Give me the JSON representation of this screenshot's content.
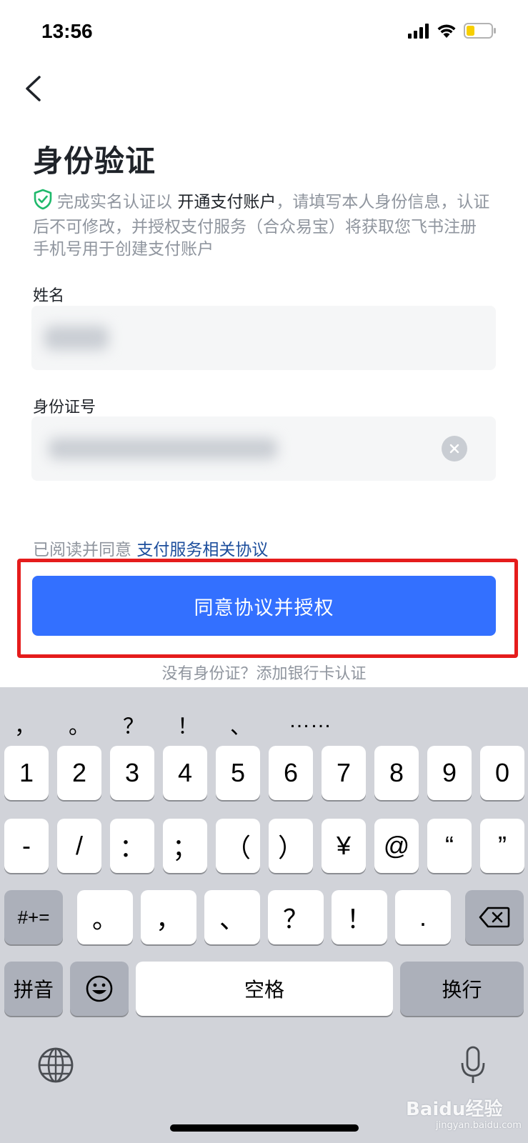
{
  "status_bar": {
    "time": "13:56"
  },
  "header": {
    "title": "身份验证"
  },
  "notice": {
    "prefix": "完成实名认证以",
    "highlight": "开通支付账户",
    "suffix": "，请填写本人身份信息，认证后不可修改，并授权支付服务（合众易宝）将获取您飞书注册手机号用于创建支付账户"
  },
  "form": {
    "name_label": "姓名",
    "id_label": "身份证号"
  },
  "agreement": {
    "prefix": "已阅读并同意",
    "link": "支付服务相关协议"
  },
  "primary_button": "同意协议并授权",
  "alt_link": "没有身份证？添加银行卡认证",
  "keyboard": {
    "suggestions": [
      "，",
      "。",
      "？",
      "！",
      "、",
      "……"
    ],
    "row1": [
      "1",
      "2",
      "3",
      "4",
      "5",
      "6",
      "7",
      "8",
      "9",
      "0"
    ],
    "row2": [
      "-",
      "/",
      "：",
      "；",
      "（",
      "）",
      "¥",
      "@",
      "“",
      "”"
    ],
    "row3_func": "#+=",
    "row3": [
      "。",
      "，",
      "、",
      "？",
      "！",
      "."
    ],
    "pinyin": "拼音",
    "space": "空格",
    "return": "换行"
  },
  "watermark": {
    "main": "Baidu经验",
    "sub": "jingyan.baidu.com"
  },
  "colors": {
    "primary": "#3370ff",
    "highlight_frame": "#e51c1c",
    "link": "#1d4e9c",
    "shield": "#1fb96b"
  }
}
